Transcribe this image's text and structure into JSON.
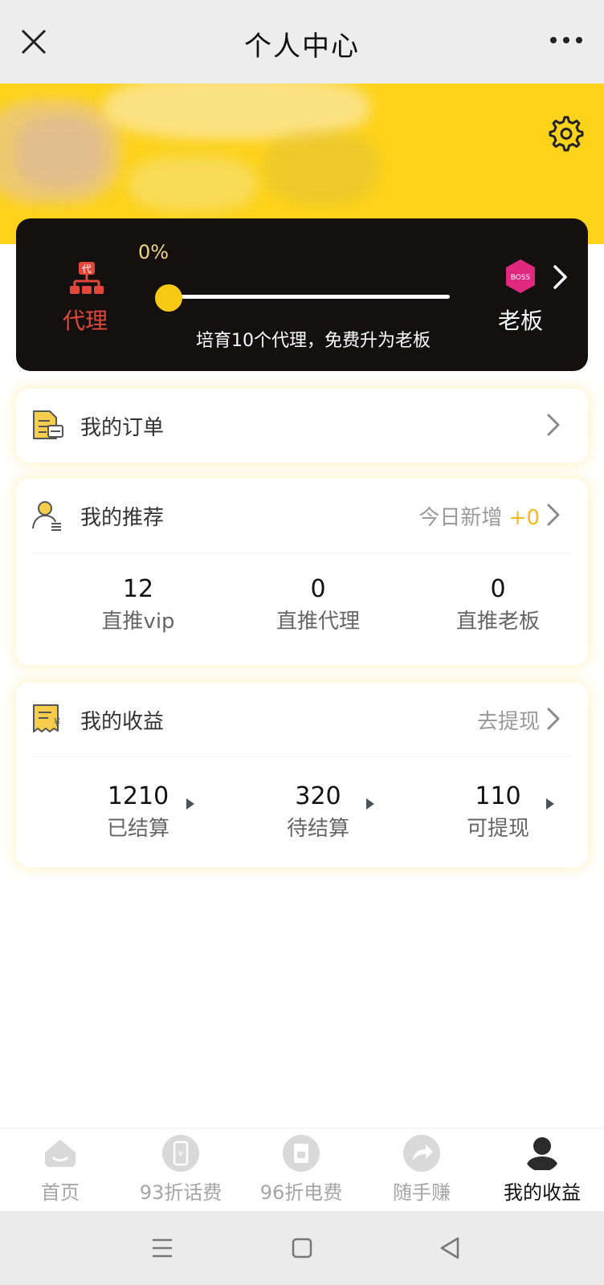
{
  "titlebar": {
    "title": "个人中心"
  },
  "level": {
    "progress_text": "0%",
    "progress": 0.0,
    "current_label": "代理",
    "agent_badge": "代",
    "next_label": "老板",
    "boss_badge": "BOSS",
    "hint": "培育10个代理，免费升为老板"
  },
  "orders": {
    "title": "我的订单"
  },
  "referrals": {
    "title": "我的推荐",
    "today_label": "今日新增",
    "today_value": "+0",
    "stats": [
      {
        "value": "12",
        "label": "直推vip"
      },
      {
        "value": "0",
        "label": "直推代理"
      },
      {
        "value": "0",
        "label": "直推老板"
      }
    ]
  },
  "earnings": {
    "title": "我的收益",
    "withdraw_label": "去提现",
    "stats": [
      {
        "value": "1210",
        "label": "已结算"
      },
      {
        "value": "320",
        "label": "待结算"
      },
      {
        "value": "110",
        "label": "可提现"
      }
    ]
  },
  "tabs": [
    {
      "label": "首页",
      "icon": "home-icon"
    },
    {
      "label": "93折话费",
      "icon": "phone-icon"
    },
    {
      "label": "96折电费",
      "icon": "electricity-icon"
    },
    {
      "label": "随手赚",
      "icon": "share-icon"
    },
    {
      "label": "我的收益",
      "icon": "profile-icon"
    }
  ],
  "active_tab": 4,
  "colors": {
    "brand_yellow": "#fdd21a",
    "card_dark": "#141010",
    "agent_red": "#e2473a",
    "boss_pink": "#e0287f",
    "accent_yellow": "#f5b820"
  }
}
